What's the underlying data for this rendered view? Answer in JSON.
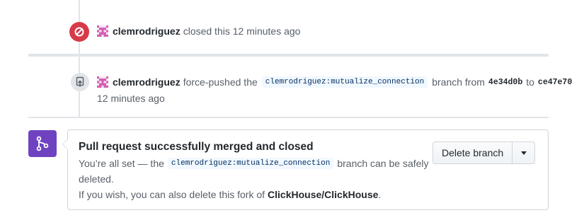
{
  "timeline": {
    "closed_event": {
      "icon": "circle-slash-icon",
      "author": "clemrodriguez",
      "text": "closed this 12 minutes ago"
    },
    "push_event": {
      "icon": "repo-push-icon",
      "author": "clemrodriguez",
      "action": "force-pushed the",
      "branch": "clemrodriguez:mutualize_connection",
      "branch_from": "branch from",
      "from_sha": "4e34d0b",
      "to": "to",
      "to_sha": "ce47e70",
      "time": "12 minutes ago"
    }
  },
  "merge_status": {
    "icon": "git-merge-icon",
    "title": "Pull request successfully merged and closed",
    "line1_prefix": "You’re all set — the",
    "branch": "clemrodriguez:mutualize_connection",
    "line1_suffix": "branch can be safely",
    "line2": "deleted.",
    "line3_prefix": "If you wish, you can also delete this fork of",
    "repo": "ClickHouse/ClickHouse",
    "line3_suffix": ".",
    "delete_button_label": "Delete branch",
    "dropdown_icon": "caret-down-icon"
  },
  "colors": {
    "closed": "#d73a49",
    "merged": "#6f42c1",
    "branch_label_bg": "#f1f8ff",
    "branch_label_text": "#032f62"
  }
}
